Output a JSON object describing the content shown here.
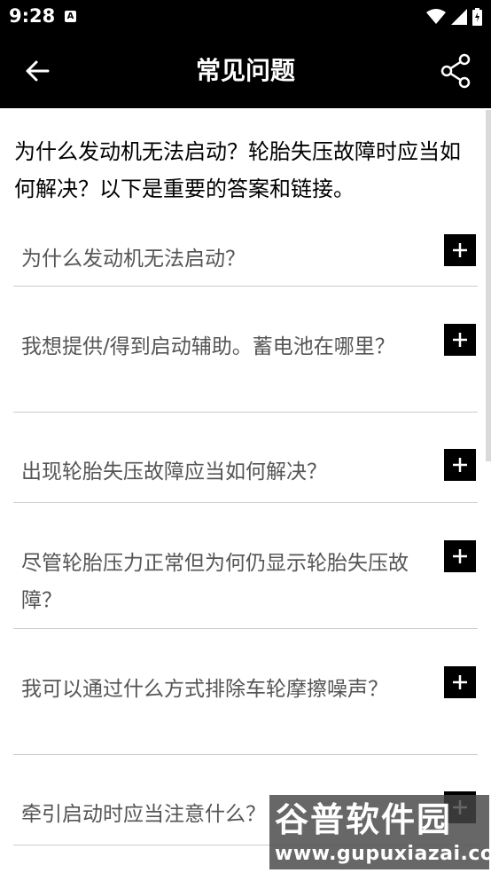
{
  "status_bar": {
    "time": "9:28",
    "notification_icon": "A"
  },
  "app_bar": {
    "title": "常见问题",
    "back_icon": "arrow-left",
    "share_icon": "share"
  },
  "intro": "为什么发动机无法启动？轮胎失压故障时应当如何解决？以下是重要的答案和链接。",
  "faq": [
    {
      "question": "为什么发动机无法启动？"
    },
    {
      "question": "我想提供/得到启动辅助。蓄电池在哪里？"
    },
    {
      "question": "出现轮胎失压故障应当如何解决？"
    },
    {
      "question": "尽管轮胎压力正常但为何仍显示轮胎失压故障？"
    },
    {
      "question": "我可以通过什么方式排除车轮摩擦噪声？"
    },
    {
      "question": "牵引启动时应当注意什么？"
    }
  ],
  "watermark": {
    "name": "谷普软件园",
    "url": "www.gupuxiazai.com"
  }
}
